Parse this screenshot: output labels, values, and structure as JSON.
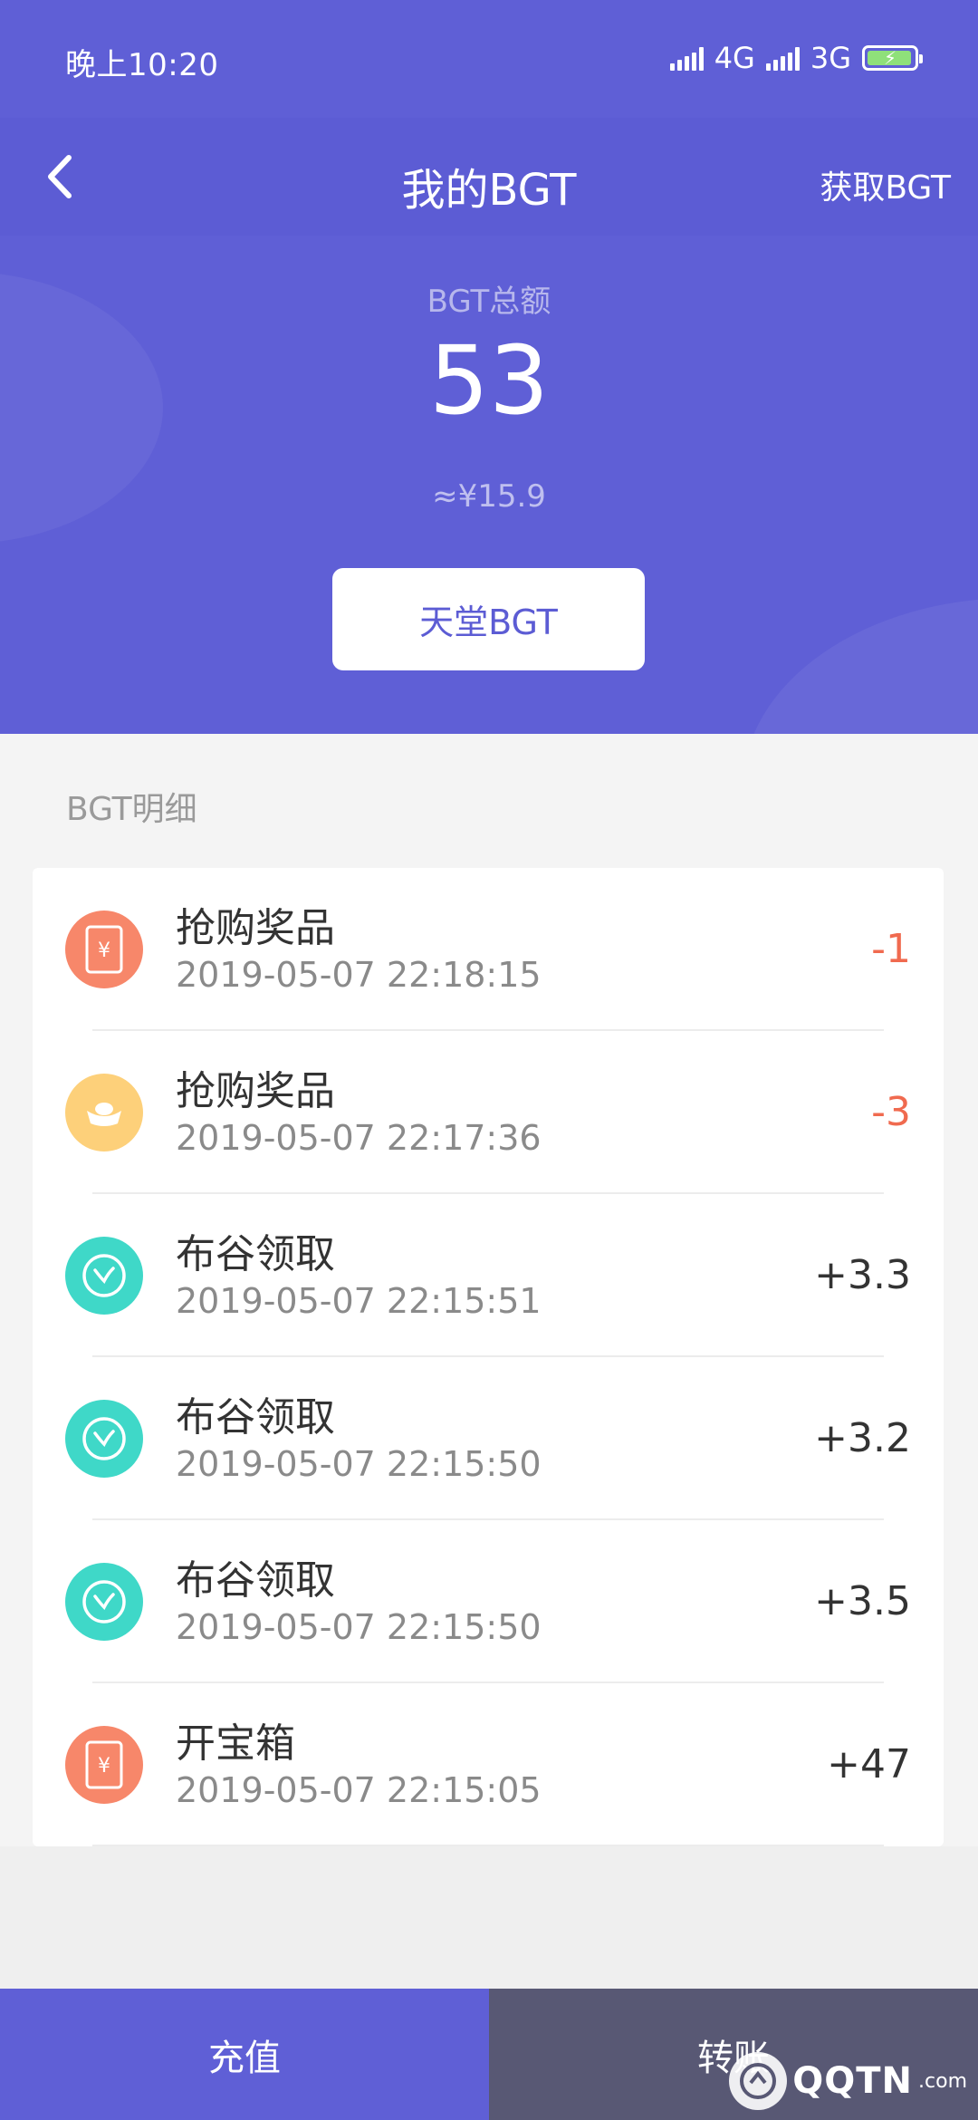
{
  "status_bar": {
    "time": "晚上10:20",
    "net1": "4G",
    "net2": "3G"
  },
  "nav": {
    "title": "我的BGT",
    "action": "获取BGT"
  },
  "balance": {
    "label": "BGT总额",
    "value": "53",
    "approx": "≈¥15.9",
    "button": "天堂BGT"
  },
  "detail": {
    "section_title": "BGT明细",
    "items": [
      {
        "title": "抢购奖品",
        "time": "2019-05-07 22:18:15",
        "amount": "-1",
        "icon": "red-envelope-icon",
        "color": "#f7876a"
      },
      {
        "title": "抢购奖品",
        "time": "2019-05-07 22:17:36",
        "amount": "-3",
        "icon": "gold-ingot-icon",
        "color": "#fdd07a"
      },
      {
        "title": "布谷领取",
        "time": "2019-05-07 22:15:51",
        "amount": "+3.3",
        "icon": "sprout-icon",
        "color": "#3fd8c8"
      },
      {
        "title": "布谷领取",
        "time": "2019-05-07 22:15:50",
        "amount": "+3.2",
        "icon": "sprout-icon",
        "color": "#3fd8c8"
      },
      {
        "title": "布谷领取",
        "time": "2019-05-07 22:15:50",
        "amount": "+3.5",
        "icon": "sprout-icon",
        "color": "#3fd8c8"
      },
      {
        "title": "开宝箱",
        "time": "2019-05-07 22:15:05",
        "amount": "+47",
        "icon": "red-envelope-icon",
        "color": "#f7876a"
      }
    ]
  },
  "bottom": {
    "recharge": "充值",
    "transfer": "转账"
  },
  "watermark": {
    "brand": "QQTN",
    "sub": ".com"
  }
}
